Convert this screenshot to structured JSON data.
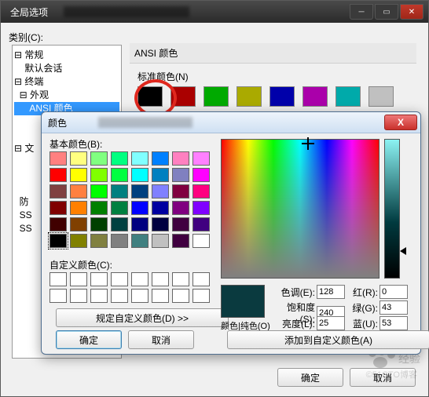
{
  "main_window": {
    "title": "全局选项",
    "category_label": "类别(C):",
    "tree": [
      {
        "indent": 0,
        "icon": "⊟",
        "label": "常规"
      },
      {
        "indent": 1,
        "icon": " ",
        "label": "默认会话"
      },
      {
        "indent": 0,
        "icon": "⊟",
        "label": "终端"
      },
      {
        "indent": 1,
        "icon": "⊟",
        "label": "外观"
      },
      {
        "indent": 2,
        "icon": " ",
        "label": "ANSI 颜色",
        "selected": true
      },
      {
        "indent": 0,
        "icon": " ",
        "label": ""
      },
      {
        "indent": 0,
        "icon": " ",
        "label": ""
      },
      {
        "indent": 0,
        "icon": "⊟",
        "label": "文"
      },
      {
        "indent": 1,
        "icon": " ",
        "label": ""
      },
      {
        "indent": 0,
        "icon": " ",
        "label": ""
      },
      {
        "indent": 0,
        "icon": " ",
        "label": ""
      },
      {
        "indent": 0,
        "icon": " ",
        "label": "防"
      },
      {
        "indent": 0,
        "icon": " ",
        "label": "SS"
      },
      {
        "indent": 0,
        "icon": " ",
        "label": "SS"
      }
    ],
    "panel": {
      "group_title": "ANSI 颜色",
      "standard_label": "标准颜色(N)",
      "swatches": [
        "#000000",
        "#aa0000",
        "#00aa00",
        "#aaaa00",
        "#0000aa",
        "#aa00aa",
        "#00aaaa",
        "#c0c0c0"
      ]
    },
    "ok": "确定",
    "cancel": "取消"
  },
  "color_dialog": {
    "title": "颜色",
    "basic_label": "基本颜色(B):",
    "basic_colors": [
      [
        "#ff8080",
        "#ffff80",
        "#80ff80",
        "#00ff80",
        "#80ffff",
        "#0080ff",
        "#ff80c0",
        "#ff80ff"
      ],
      [
        "#ff0000",
        "#ffff00",
        "#80ff00",
        "#00ff40",
        "#00ffff",
        "#0080c0",
        "#8080c0",
        "#ff00ff"
      ],
      [
        "#804040",
        "#ff8040",
        "#00ff00",
        "#008080",
        "#004080",
        "#8080ff",
        "#800040",
        "#ff0080"
      ],
      [
        "#800000",
        "#ff8000",
        "#008000",
        "#008040",
        "#0000ff",
        "#0000a0",
        "#800080",
        "#8000ff"
      ],
      [
        "#400000",
        "#804000",
        "#004000",
        "#004040",
        "#000080",
        "#000040",
        "#400040",
        "#400080"
      ],
      [
        "#000000",
        "#808000",
        "#808040",
        "#808080",
        "#408080",
        "#c0c0c0",
        "#400040",
        "#ffffff"
      ]
    ],
    "custom_label": "自定义颜色(C):",
    "define_label": "规定自定义颜色(D) >>",
    "ok": "确定",
    "cancel": "取消",
    "solid_label": "颜色|纯色(O)",
    "preview_color": "#0a3a3f",
    "fields": {
      "hue_label": "色调(E):",
      "hue": "128",
      "sat_label": "饱和度(S):",
      "sat": "240",
      "lum_label": "亮度(L):",
      "lum": "25",
      "red_label": "红(R):",
      "red": "0",
      "green_label": "绿(G):",
      "green": "43",
      "blue_label": "蓝(U):",
      "blue": "53"
    },
    "add_label": "添加到自定义颜色(A)"
  },
  "watermark": {
    "text": "经验",
    "sub": "©51CTO博客"
  }
}
